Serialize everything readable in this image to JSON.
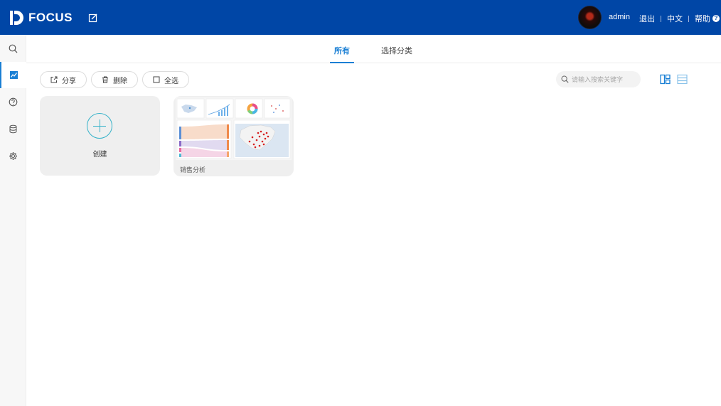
{
  "app": {
    "logo_text": "FOCUS"
  },
  "header": {
    "username": "admin",
    "logout": "退出",
    "language": "中文",
    "help": "帮助",
    "help_icon": "?"
  },
  "sidebar": {
    "items": [
      {
        "icon": "search-icon",
        "active": false
      },
      {
        "icon": "dashboard-icon",
        "active": true
      },
      {
        "icon": "help-circle-icon",
        "active": false
      },
      {
        "icon": "database-icon",
        "active": false
      },
      {
        "icon": "gear-icon",
        "active": false
      }
    ]
  },
  "tabs": [
    {
      "label": "所有",
      "active": true
    },
    {
      "label": "选择分类",
      "active": false
    }
  ],
  "toolbar": {
    "share_label": "分享",
    "delete_label": "删除",
    "select_all_label": "全选",
    "search_placeholder": "请输入搜索关键字"
  },
  "cards": {
    "create_label": "创建",
    "dashboards": [
      {
        "name": "销售分析"
      }
    ]
  },
  "colors": {
    "header_bg": "#0046a6",
    "accent": "#1a7fd4",
    "create_plus": "#35b2c9",
    "card_bg": "#efefef"
  }
}
